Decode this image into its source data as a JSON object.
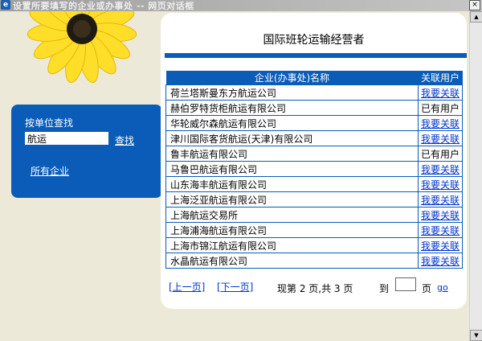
{
  "window": {
    "title": "设置所要填写的企业或办事处 -- 网页对话框",
    "close_glyph": "×"
  },
  "scrollbar": {
    "up_glyph": "▲",
    "down_glyph": "▼"
  },
  "search_panel": {
    "label": "按单位查找",
    "input_value": "航运",
    "find_link": "查找",
    "all_link": "所有企业"
  },
  "main": {
    "heading": "国际班轮运输经营者",
    "table": {
      "headers": [
        "企业(办事处)名称",
        "关联用户"
      ],
      "rows": [
        {
          "name": "荷兰塔斯曼东方航运公司",
          "relation": "我要关联",
          "link": true
        },
        {
          "name": "赫伯罗特货柜航运有限公司",
          "relation": "已有用户",
          "link": false
        },
        {
          "name": "华轮威尔森航运有限公司",
          "relation": "我要关联",
          "link": true
        },
        {
          "name": "津川国际客货航运(天津)有限公司",
          "relation": "我要关联",
          "link": true
        },
        {
          "name": "鲁丰航运有限公司",
          "relation": "已有用户",
          "link": false
        },
        {
          "name": "马鲁巴航运有限公司",
          "relation": "我要关联",
          "link": true
        },
        {
          "name": "山东海丰航运有限公司",
          "relation": "我要关联",
          "link": true
        },
        {
          "name": "上海泛亚航运有限公司",
          "relation": "我要关联",
          "link": true
        },
        {
          "name": "上海航运交易所",
          "relation": "我要关联",
          "link": true
        },
        {
          "name": "上海浦海航运有限公司",
          "relation": "我要关联",
          "link": true
        },
        {
          "name": "上海市锦江航运有限公司",
          "relation": "我要关联",
          "link": true
        },
        {
          "name": "水晶航运有限公司",
          "relation": "我要关联",
          "link": true
        }
      ]
    },
    "pager": {
      "prev": "[上一页]",
      "next": "[下一页]",
      "info": "现第 2 页,共 3 页",
      "goto_label": "到",
      "page_input": "",
      "page_unit": "页",
      "go": "go"
    }
  },
  "colors": {
    "accent": "#0a5cb8",
    "link": "#0033cc",
    "background": "#ece9d8"
  }
}
